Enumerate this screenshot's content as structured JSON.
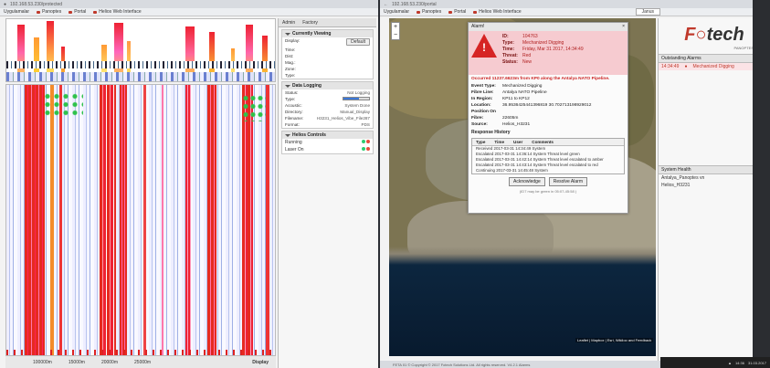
{
  "left_browser": {
    "address": "192.168.53.230/protected",
    "bookmarks": [
      "Uygulamalar",
      "Panoptes",
      "Portal",
      "Helios Web Interface"
    ]
  },
  "waterfall": {
    "x_ticks": [
      "100000m",
      "15000m",
      "20000m",
      "25000m"
    ],
    "display_label": "Display"
  },
  "side_panel": {
    "tabs": [
      "Admin",
      "Factory"
    ],
    "current_viewing": {
      "title": "Currently Viewing",
      "display_label": "Display:",
      "default_button": "Default",
      "fields": [
        "Time:",
        "Dist:",
        "Mag.:",
        "Zone:",
        "Type:"
      ]
    },
    "data_logging": {
      "title": "Data Logging",
      "rows": [
        {
          "k": "Status:",
          "v": "Not Logging"
        },
        {
          "k": "Type:",
          "v": "decimated"
        },
        {
          "k": "Acoustic:",
          "v": "System Done"
        },
        {
          "k": "Directory:",
          "v": "Manual_Display"
        },
        {
          "k": "Filename:",
          "v": "H3231_Helios_Vibe_File287"
        },
        {
          "k": "Format:",
          "v": "PDS"
        }
      ]
    },
    "helios_controls": {
      "title": "Helios Controls",
      "items": [
        "Running",
        "Laser On"
      ]
    }
  },
  "right_browser": {
    "address": "192.168.53.230/portal",
    "bookmarks": [
      "Uygulamalar",
      "Panoptes",
      "Portal",
      "Helios Web Interface"
    ],
    "user": "Janus",
    "status": "FETA 01 © Copyright © 2017 Fotech Solutions Ltd. All rights reserved. V4.2.1 Alarms"
  },
  "map": {
    "attribution": "Leaflet | Mapbox | Esri, Wikiloo and Feedback",
    "zoom_in": "+",
    "zoom_out": "−"
  },
  "alarm": {
    "window_title": "Alarm!",
    "fields": [
      {
        "k": "ID:",
        "v": "104763"
      },
      {
        "k": "Type:",
        "v": "Mechanized Digging"
      },
      {
        "k": "Time:",
        "v": "Friday, Mar 31 2017, 14:34:49"
      },
      {
        "k": "Threat:",
        "v": "Red"
      },
      {
        "k": "Status:",
        "v": "New"
      }
    ],
    "occurred": "Occurred 11237.6623m from KP0 along the Antalya NATO Pipeline.",
    "details": [
      {
        "k": "Event Type:",
        "v": "Mechanized Digging"
      },
      {
        "k": "Fibre Line:",
        "v": "Antalya NATO Pipeline"
      },
      {
        "k": "In Region:",
        "v": "KP11 to KP12"
      },
      {
        "k": "Location:",
        "v": "36.9536425441396819 30.702713198929012"
      },
      {
        "k": "Position On Fibre:",
        "v": "22605m"
      },
      {
        "k": "Source:",
        "v": "Helios_H3231"
      }
    ],
    "history_title": "Response History",
    "history_cols": [
      "Type",
      "Time",
      "User",
      "Comments"
    ],
    "history": [
      "Received 2017-03-31 14:34:49 System",
      "Escalated 2017-03-31 14:36:14 System Threat level green",
      "Escalated 2017-03-31 14:42:14 System Threat level escalated to amber",
      "Escalated 2017-03-31 14:43:14 System Threat level escalated to red",
      "Continuing 2017-03-31 14:45:48 System"
    ],
    "buttons": [
      "Acknowledge",
      "Resolve Alarm"
    ],
    "footer": "(ID7 may be green in 05:07-45:58 )"
  },
  "right_panel": {
    "logo_a": "F",
    "logo_b": "tech",
    "logo_sub": "PANOPTES",
    "outstanding_title": "Outstanding Alarms",
    "outstanding": [
      {
        "time": "14:34:49",
        "type": "Mechanized Digging"
      }
    ],
    "system_health_title": "System Health",
    "health": [
      {
        "name": "Antalya_Panoptes vn",
        "status": ""
      },
      {
        "name": "Helios_H3231",
        "status": ""
      }
    ]
  },
  "taskbar": {
    "time": "14:36",
    "date": "31.03.2017"
  }
}
